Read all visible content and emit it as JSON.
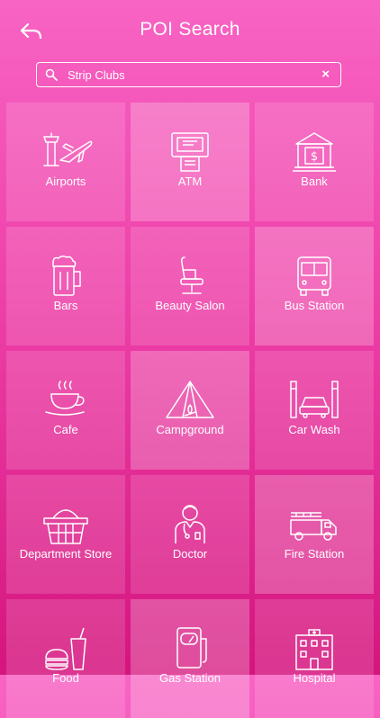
{
  "header": {
    "title": "POI Search",
    "back_icon": "back-arrow-icon"
  },
  "search": {
    "value": "Strip Clubs",
    "clear_label": "×",
    "icon": "search-icon"
  },
  "tiles": [
    {
      "label": "Airports",
      "icon": "airport-icon"
    },
    {
      "label": "ATM",
      "icon": "atm-icon"
    },
    {
      "label": "Bank",
      "icon": "bank-icon"
    },
    {
      "label": "Bars",
      "icon": "beer-mug-icon"
    },
    {
      "label": "Beauty Salon",
      "icon": "salon-chair-icon"
    },
    {
      "label": "Bus Station",
      "icon": "bus-icon"
    },
    {
      "label": "Cafe",
      "icon": "coffee-cup-icon"
    },
    {
      "label": "Campground",
      "icon": "tent-icon"
    },
    {
      "label": "Car Wash",
      "icon": "car-wash-icon"
    },
    {
      "label": "Department Store",
      "icon": "basket-icon"
    },
    {
      "label": "Doctor",
      "icon": "doctor-icon"
    },
    {
      "label": "Fire Station",
      "icon": "fire-truck-icon"
    },
    {
      "label": "Food",
      "icon": "food-icon"
    },
    {
      "label": "Gas Station",
      "icon": "fuel-pump-icon"
    },
    {
      "label": "Hospital",
      "icon": "hospital-icon"
    }
  ]
}
